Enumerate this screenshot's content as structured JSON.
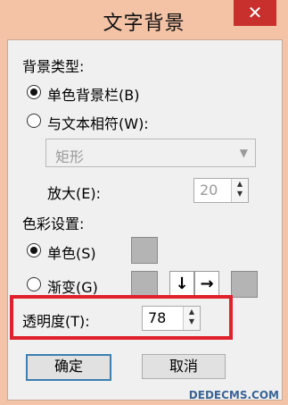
{
  "window": {
    "title": "文字背景",
    "close_glyph": "✕"
  },
  "background_type": {
    "heading": "背景类型:",
    "option_single": "单色背景栏(B)",
    "option_fit": "与文本相符(W):",
    "shape_value": "矩形",
    "zoom_label": "放大(E):",
    "zoom_value": "20"
  },
  "color": {
    "heading": "色彩设置:",
    "option_solid": "单色(S)",
    "option_gradient": "渐变(G)",
    "dir_down": "↓",
    "dir_right": "→"
  },
  "transparency": {
    "label": "透明度(T):",
    "value": "78"
  },
  "buttons": {
    "ok": "确定",
    "cancel": "取消"
  },
  "watermark": {
    "text": "DEDECMS.COM"
  }
}
